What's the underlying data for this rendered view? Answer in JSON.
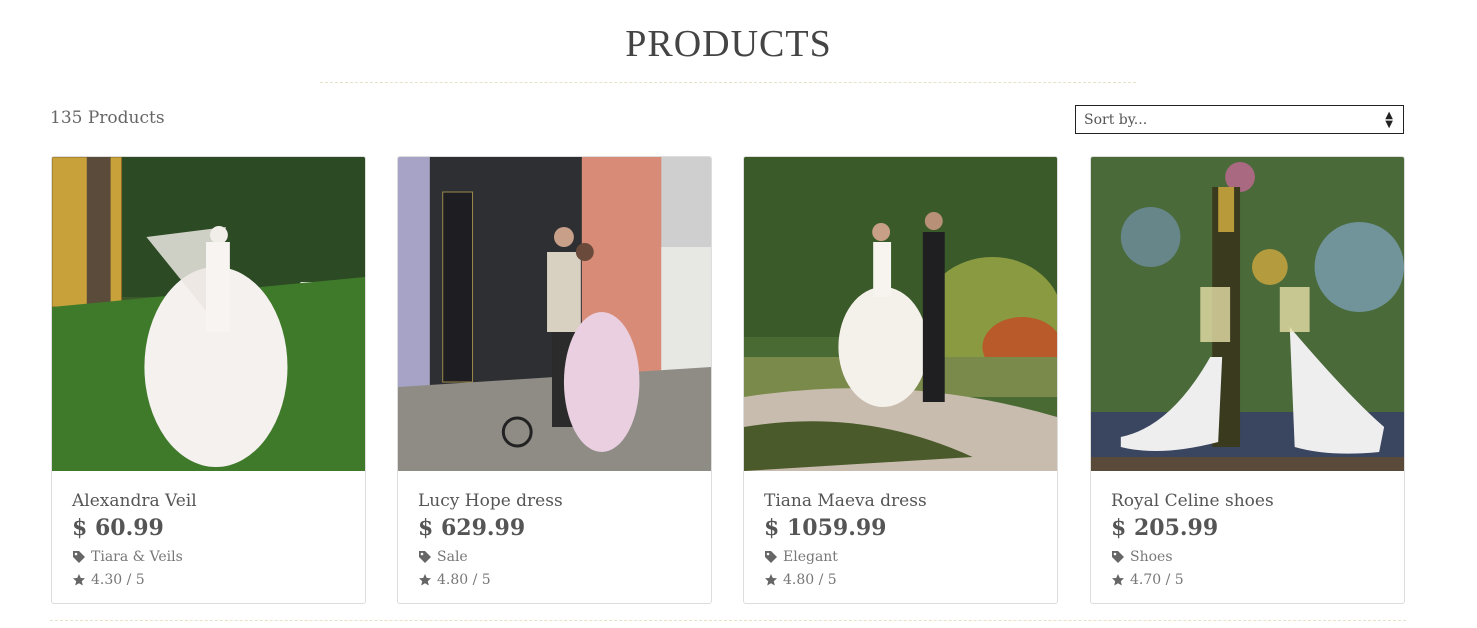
{
  "header": {
    "title": "PRODUCTS"
  },
  "toolbar": {
    "count_label": "135 Products",
    "sort_placeholder": "Sort by..."
  },
  "products": [
    {
      "name": "Alexandra Veil",
      "price": "$ 60.99",
      "category": "Tiara & Veils",
      "rating": "4.30 / 5"
    },
    {
      "name": "Lucy Hope dress",
      "price": "$ 629.99",
      "category": "Sale",
      "rating": "4.80 / 5"
    },
    {
      "name": "Tiana Maeva dress",
      "price": "$ 1059.99",
      "category": "Elegant",
      "rating": "4.80 / 5"
    },
    {
      "name": "Royal Celine shoes",
      "price": "$ 205.99",
      "category": "Shoes",
      "rating": "4.70 / 5"
    }
  ],
  "icons": {
    "category": "tag-icon",
    "rating": "star-icon",
    "sort": "sort-arrows-icon"
  }
}
